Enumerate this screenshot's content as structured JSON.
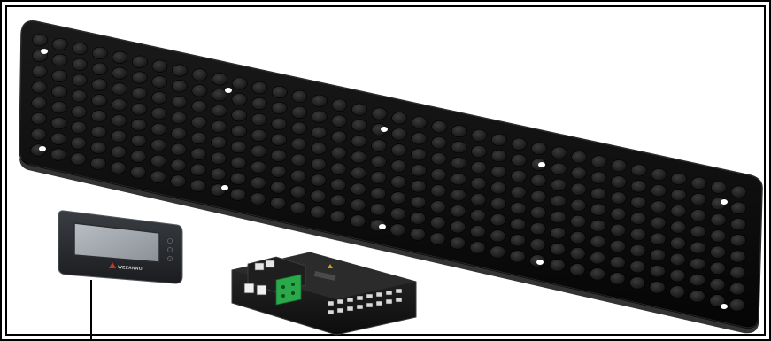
{
  "scene": {
    "frame": "double-black-border",
    "components": [
      {
        "name": "led-matrix-panel",
        "description_visible": false,
        "dot_color": "#1c1c1c",
        "mount_marker_color": "#ffffff"
      },
      {
        "name": "remote-display-unit",
        "brand_text": "WEZANNO"
      },
      {
        "name": "controller-module",
        "terminal_color": "#2aa84a"
      }
    ]
  },
  "colors": {
    "panel": "#0b0b0b",
    "panel_edge": "#2a2a2a",
    "dot": "#1e1e1e",
    "dot_highlight": "#3a3a3a",
    "marker": "#ffffff",
    "screen": "#9aa0a6",
    "green_terminal": "#2aa84a"
  }
}
